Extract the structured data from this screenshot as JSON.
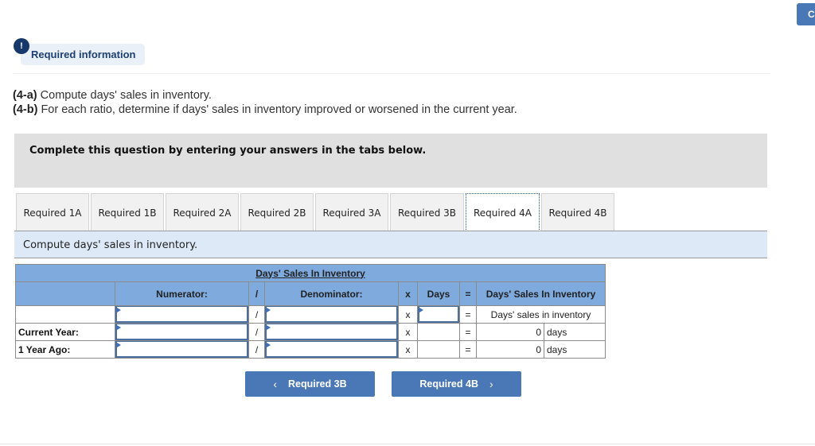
{
  "corner_button": {
    "label": "C"
  },
  "required_info": {
    "icon": "exclamation-icon",
    "icon_glyph": "!",
    "label": "Required information"
  },
  "instructions": [
    {
      "tag": "(4-a)",
      "text": " Compute days' sales in inventory."
    },
    {
      "tag": "(4-b)",
      "text": " For each ratio, determine if days' sales in inventory improved or worsened in the current year."
    }
  ],
  "complete_box": {
    "text": "Complete this question by entering your answers in the tabs below."
  },
  "tabs": [
    {
      "label": "Required 1A",
      "active": false
    },
    {
      "label": "Required 1B",
      "active": false
    },
    {
      "label": "Required 2A",
      "active": false
    },
    {
      "label": "Required 2B",
      "active": false
    },
    {
      "label": "Required 3A",
      "active": false
    },
    {
      "label": "Required 3B",
      "active": false
    },
    {
      "label": "Required 4A",
      "active": true
    },
    {
      "label": "Required 4B",
      "active": false
    }
  ],
  "prompt": "Compute days' sales in inventory.",
  "table": {
    "title": "Days' Sales In Inventory",
    "headers": {
      "numerator": "Numerator:",
      "divide": "/",
      "denominator": "Denominator:",
      "times": "x",
      "days": "Days",
      "equals": "=",
      "result": "Days' Sales In Inventory"
    },
    "rows": [
      {
        "label": "",
        "numerator": "",
        "divide": "/",
        "denominator": "",
        "times": "x",
        "days": "",
        "equals": "=",
        "result_label": "Days' sales in inventory"
      },
      {
        "label": "Current Year:",
        "numerator": "",
        "divide": "/",
        "denominator": "",
        "times": "x",
        "days": "",
        "equals": "=",
        "result_value": "0",
        "result_unit": "days"
      },
      {
        "label": "1 Year Ago:",
        "numerator": "",
        "divide": "/",
        "denominator": "",
        "times": "x",
        "days": "",
        "equals": "=",
        "result_value": "0",
        "result_unit": "days"
      }
    ]
  },
  "nav": {
    "prev": {
      "chevron": "‹",
      "label": "Required 3B"
    },
    "next": {
      "label": "Required 4B",
      "chevron": "›"
    }
  }
}
